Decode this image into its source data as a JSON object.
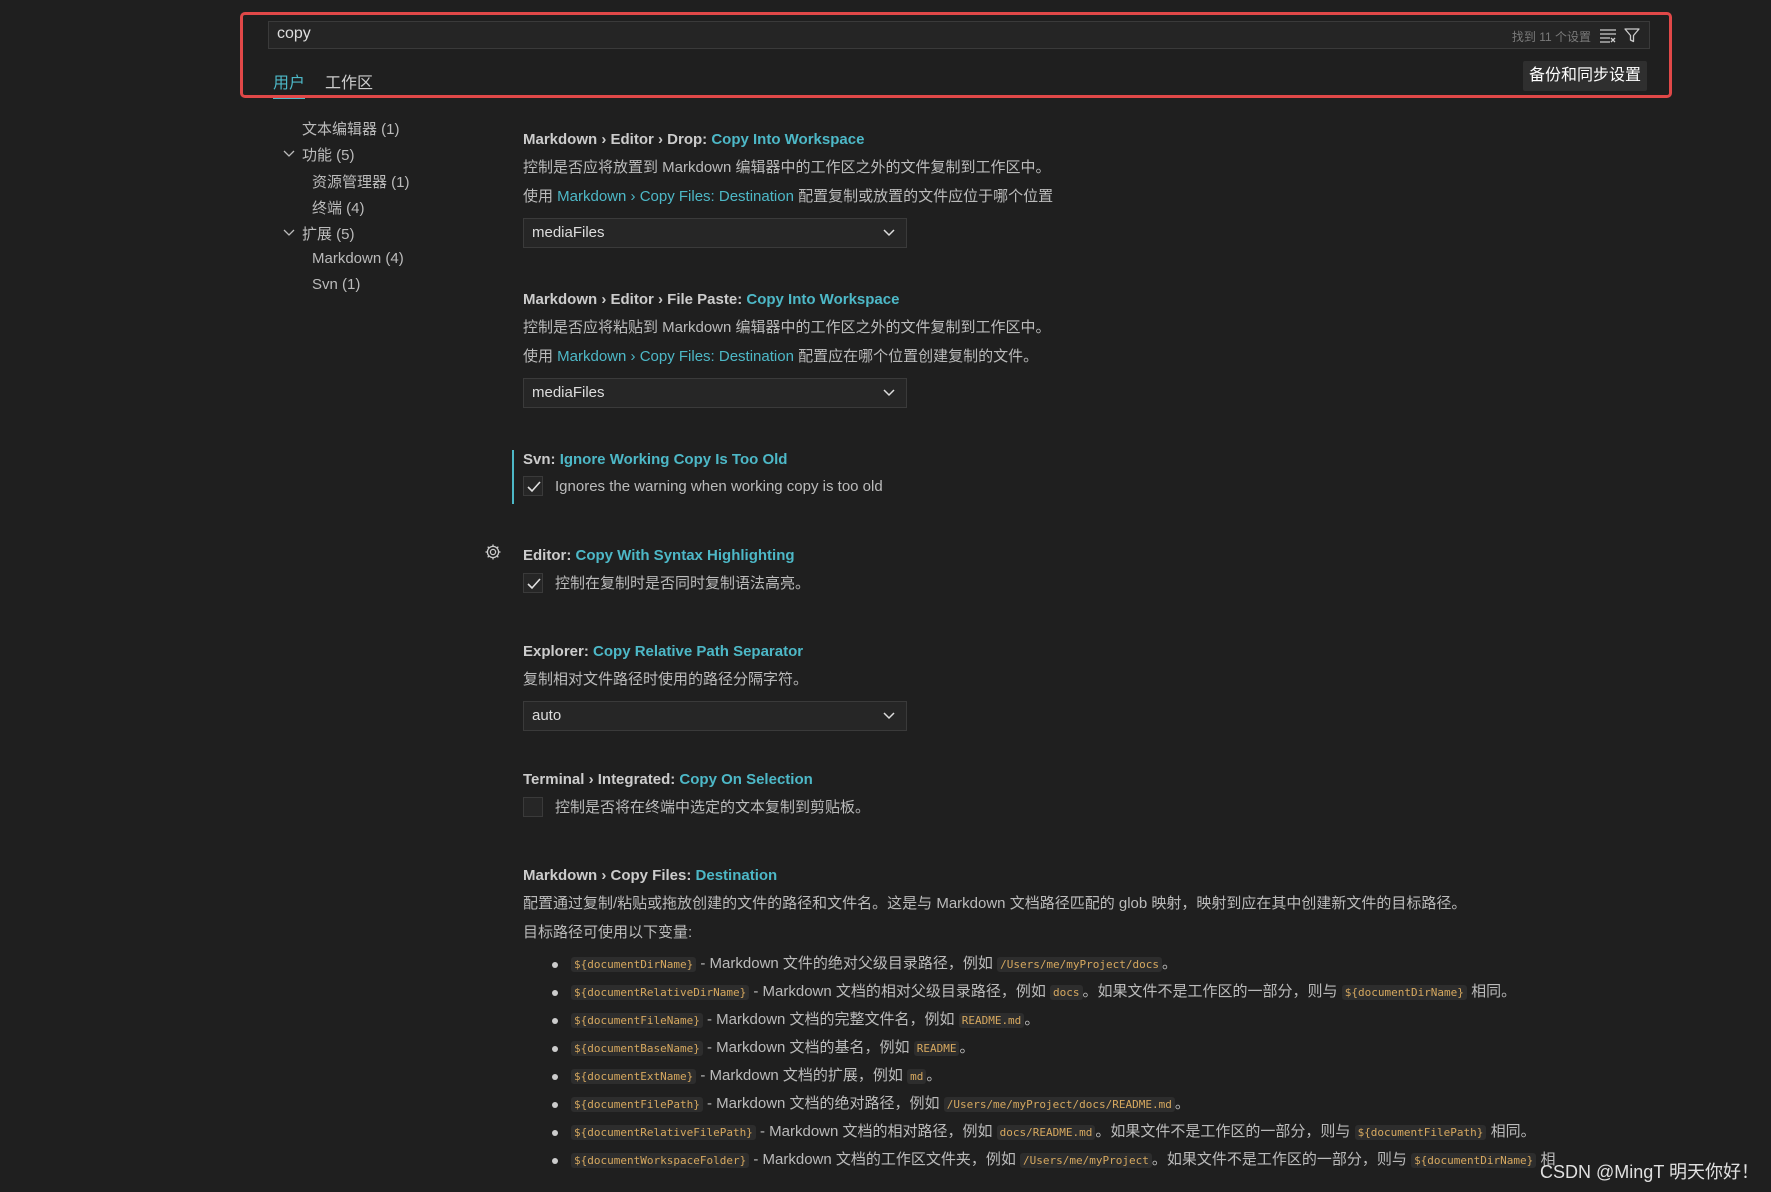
{
  "search": {
    "value": "copy",
    "result_count": "找到 11 个设置",
    "clear_icon": "clear-filter-icon",
    "filter_icon": "filter-icon"
  },
  "tabs": [
    {
      "label": "用户",
      "active": true
    },
    {
      "label": "工作区",
      "active": false
    }
  ],
  "sync_button_label": "备份和同步设置",
  "toc": [
    {
      "label": "文本编辑器 (1)"
    },
    {
      "label": "功能 (5)",
      "expanded": true
    },
    {
      "label": "资源管理器 (1)"
    },
    {
      "label": "终端 (4)"
    },
    {
      "label": "扩展 (5)",
      "expanded": true
    },
    {
      "label": "Markdown (4)"
    },
    {
      "label": "Svn (1)"
    }
  ],
  "settings": [
    {
      "prefix": "Markdown › Editor › Drop: ",
      "key": "Copy Into Workspace",
      "desc1": "控制是否应将放置到 Markdown 编辑器中的工作区之外的文件复制到工作区中。",
      "desc2_pre": "使用 ",
      "desc2_link": "Markdown › Copy Files: Destination",
      "desc2_post": " 配置复制或放置的文件应位于哪个位置",
      "select_value": "mediaFiles"
    },
    {
      "prefix": "Markdown › Editor › File Paste: ",
      "key": "Copy Into Workspace",
      "desc1": "控制是否应将粘贴到 Markdown 编辑器中的工作区之外的文件复制到工作区中。",
      "desc2_pre": "使用 ",
      "desc2_link": "Markdown › Copy Files: Destination",
      "desc2_post": " 配置应在哪个位置创建复制的文件。",
      "select_value": "mediaFiles"
    },
    {
      "prefix": "Svn: ",
      "key": "Ignore Working Copy Is Too Old",
      "checkbox_label": "Ignores the warning when working copy is too old",
      "checked": true
    },
    {
      "prefix": "Editor: ",
      "key": "Copy With Syntax Highlighting",
      "checkbox_label": "控制在复制时是否同时复制语法高亮。",
      "checked": true
    },
    {
      "prefix": "Explorer: ",
      "key": "Copy Relative Path Separator",
      "desc1": "复制相对文件路径时使用的路径分隔字符。",
      "select_value": "auto"
    },
    {
      "prefix": "Terminal › Integrated: ",
      "key": "Copy On Selection",
      "checkbox_label": "控制是否将在终端中选定的文本复制到剪贴板。",
      "checked": false
    },
    {
      "prefix": "Markdown › Copy Files: ",
      "key": "Destination",
      "desc1": "配置通过复制/粘贴或拖放创建的文件的路径和文件名。这是与 Markdown 文档路径匹配的 glob 映射，映射到应在其中创建新文件的目标路径。",
      "desc2": "目标路径可使用以下变量:"
    }
  ],
  "variables": [
    {
      "code": "${documentDirName}",
      "text": " - Markdown 文件的绝对父级目录路径，例如 ",
      "ex": "/Users/me/myProject/docs",
      "tail": "。"
    },
    {
      "code": "${documentRelativeDirName}",
      "text": " - Markdown 文档的相对父级目录路径，例如 ",
      "ex": "docs",
      "tail": "。如果文件不是工作区的一部分，则与 ",
      "code2": "${documentDirName}",
      "tail2": " 相同。"
    },
    {
      "code": "${documentFileName}",
      "text": " - Markdown 文档的完整文件名，例如 ",
      "ex": "README.md",
      "tail": "。"
    },
    {
      "code": "${documentBaseName}",
      "text": " - Markdown 文档的基名，例如 ",
      "ex": "README",
      "tail": "。"
    },
    {
      "code": "${documentExtName}",
      "text": " - Markdown 文档的扩展，例如 ",
      "ex": "md",
      "tail": "。"
    },
    {
      "code": "${documentFilePath}",
      "text": " - Markdown 文档的绝对路径，例如 ",
      "ex": "/Users/me/myProject/docs/README.md",
      "tail": "。"
    },
    {
      "code": "${documentRelativeFilePath}",
      "text": " - Markdown 文档的相对路径，例如 ",
      "ex": "docs/README.md",
      "tail": "。如果文件不是工作区的一部分，则与 ",
      "code2": "${documentFilePath}",
      "tail2": " 相同。"
    },
    {
      "code": "${documentWorkspaceFolder}",
      "text": " - Markdown 文档的工作区文件夹，例如 ",
      "ex": "/Users/me/myProject",
      "tail": "。如果文件不是工作区的一部分，则与 ",
      "code2": "${documentDirName}",
      "tail2": " 相"
    }
  ],
  "watermark": "CSDN @MingT 明天你好！",
  "colors": {
    "accent": "#4db8c7",
    "highlight_border": "#e04848",
    "background": "#1f1f1f"
  }
}
